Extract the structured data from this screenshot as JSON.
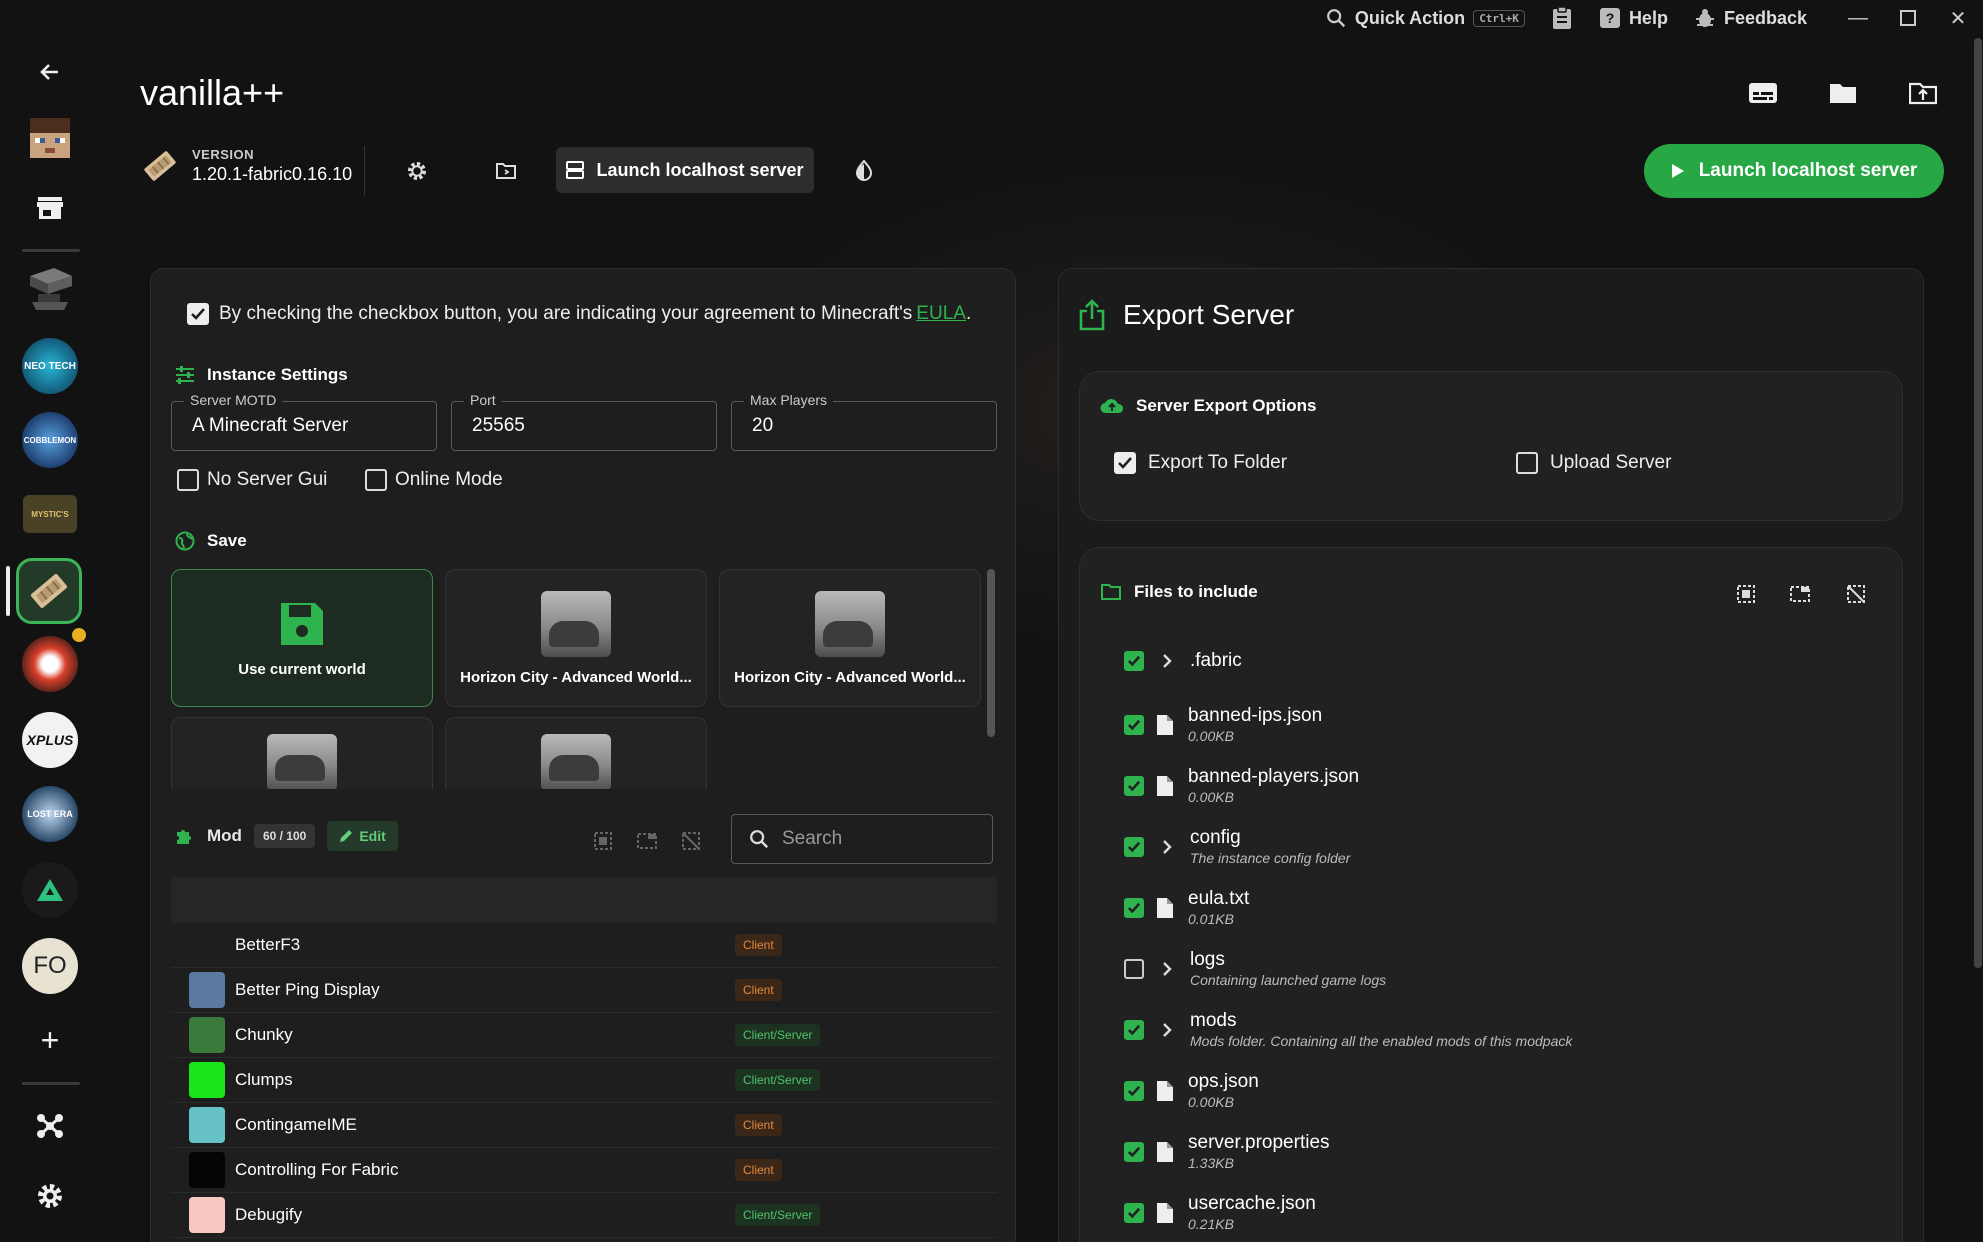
{
  "window": {
    "quick_action": "Quick Action",
    "shortcut": "Ctrl+K",
    "help": "Help",
    "feedback": "Feedback"
  },
  "header": {
    "title": "vanilla++",
    "version_label": "VERSION",
    "version_value": "1.20.1-fabric0.16.10",
    "launch_small": "Launch localhost server",
    "launch_big": "Launch localhost server"
  },
  "sidebar": {
    "avatars": [
      {
        "label": "",
        "color": "#8a6a4a"
      },
      {
        "label": "NEO TECH",
        "color": "#1d6f8a"
      },
      {
        "label": "COBBLEMON",
        "color": "#2a5c8a"
      },
      {
        "label": "MYSTIC'S",
        "color": "#6a5a2a"
      },
      {
        "label": "",
        "color": "#b89b72"
      },
      {
        "label": "",
        "color": "#b23a2a"
      },
      {
        "label": "XPLUS",
        "color": "#f2f2f2"
      },
      {
        "label": "LOST ERA",
        "color": "#2a4a6a"
      },
      {
        "label": "",
        "color": "#1a1a1a"
      },
      {
        "label": "FO",
        "color": "#e8e2d2"
      }
    ]
  },
  "eula": {
    "text": "By checking the checkbox button, you are indicating your agreement to Minecraft's",
    "link": "EULA",
    "period": "."
  },
  "instance": {
    "heading": "Instance Settings",
    "motd_label": "Server MOTD",
    "motd_value": "A Minecraft Server",
    "port_label": "Port",
    "port_value": "25565",
    "max_label": "Max Players",
    "max_value": "20",
    "no_gui": "No Server Gui",
    "online_mode": "Online Mode"
  },
  "save": {
    "heading": "Save",
    "current": "Use current world",
    "worlds": [
      "Horizon City - Advanced World...",
      "Horizon City - Advanced World..."
    ]
  },
  "mods": {
    "heading": "Mod",
    "count": "60 / 100",
    "edit": "Edit",
    "search_placeholder": "Search",
    "rows": [
      {
        "name": "BetterF3",
        "tag": "Client",
        "color": "#1e1e1e"
      },
      {
        "name": "Better Ping Display",
        "tag": "Client",
        "color": "#5a7aa0"
      },
      {
        "name": "Chunky",
        "tag": "Client/Server",
        "color": "#3a7a3a"
      },
      {
        "name": "Clumps",
        "tag": "Client/Server",
        "color": "#19e619"
      },
      {
        "name": "ContingameIME",
        "tag": "Client",
        "color": "#66c2c8"
      },
      {
        "name": "Controlling For Fabric",
        "tag": "Client",
        "color": "#050505"
      },
      {
        "name": "Debugify",
        "tag": "Client/Server",
        "color": "#f7c8c0"
      }
    ]
  },
  "export": {
    "title": "Export Server",
    "options_heading": "Server Export Options",
    "export_folder": "Export To Folder",
    "upload": "Upload Server",
    "files_heading": "Files to include",
    "files": [
      {
        "name": ".fabric",
        "sub": "",
        "type": "folder",
        "checked": true
      },
      {
        "name": "banned-ips.json",
        "sub": "0.00KB",
        "type": "file",
        "checked": true
      },
      {
        "name": "banned-players.json",
        "sub": "0.00KB",
        "type": "file",
        "checked": true
      },
      {
        "name": "config",
        "sub": "The instance config folder",
        "type": "folder",
        "checked": true
      },
      {
        "name": "eula.txt",
        "sub": "0.01KB",
        "type": "file",
        "checked": true
      },
      {
        "name": "logs",
        "sub": "Containing launched game logs",
        "type": "folder",
        "checked": false
      },
      {
        "name": "mods",
        "sub": "Mods folder. Containing all the enabled mods of this modpack",
        "type": "folder",
        "checked": true
      },
      {
        "name": "ops.json",
        "sub": "0.00KB",
        "type": "file",
        "checked": true
      },
      {
        "name": "server.properties",
        "sub": "1.33KB",
        "type": "file",
        "checked": true
      },
      {
        "name": "usercache.json",
        "sub": "0.21KB",
        "type": "file",
        "checked": true
      }
    ]
  },
  "colors": {
    "accent": "#27a844",
    "client_tag": "#e4883a",
    "cs_tag": "#52c16a"
  }
}
